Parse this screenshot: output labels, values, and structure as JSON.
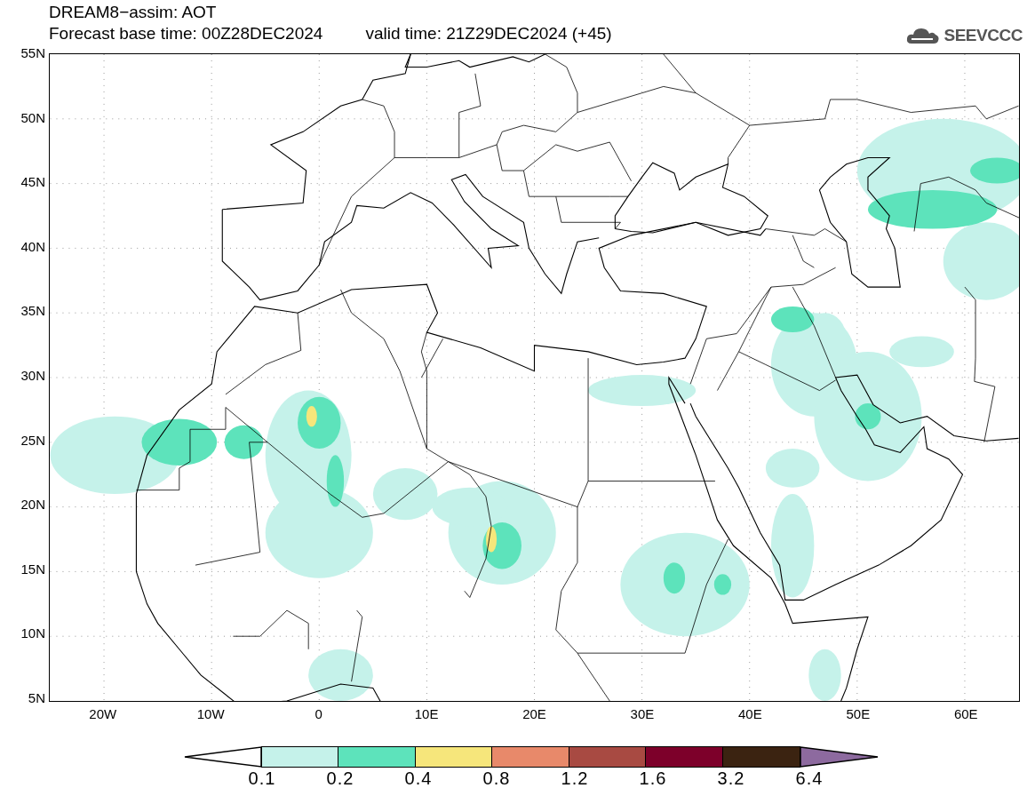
{
  "title": "DREAM8−assim: AOT",
  "subtitle": {
    "base_time": "Forecast base time: 00Z28DEC2024",
    "valid_time": "valid time: 21Z29DEC2024 (+45)"
  },
  "logo": {
    "text": "SEEVCCC"
  },
  "map": {
    "lat_labels": [
      "55N",
      "50N",
      "45N",
      "40N",
      "35N",
      "30N",
      "25N",
      "20N",
      "15N",
      "10N",
      "5N"
    ],
    "lon_labels": [
      "20W",
      "10W",
      "0",
      "10E",
      "20E",
      "30E",
      "40E",
      "50E",
      "60E"
    ]
  },
  "colorbar": {
    "bins": [
      {
        "color": "#ffffff"
      },
      {
        "color": "#c5f2ea"
      },
      {
        "color": "#5de3bb"
      },
      {
        "color": "#f6e67b"
      },
      {
        "color": "#e8896a"
      },
      {
        "color": "#a84a42"
      },
      {
        "color": "#7d002a"
      },
      {
        "color": "#3b2311"
      },
      {
        "color": "#8d6a9f"
      }
    ],
    "labels": [
      "0.1",
      "0.2",
      "0.4",
      "0.8",
      "1.2",
      "1.6",
      "3.2",
      "6.4"
    ]
  }
}
